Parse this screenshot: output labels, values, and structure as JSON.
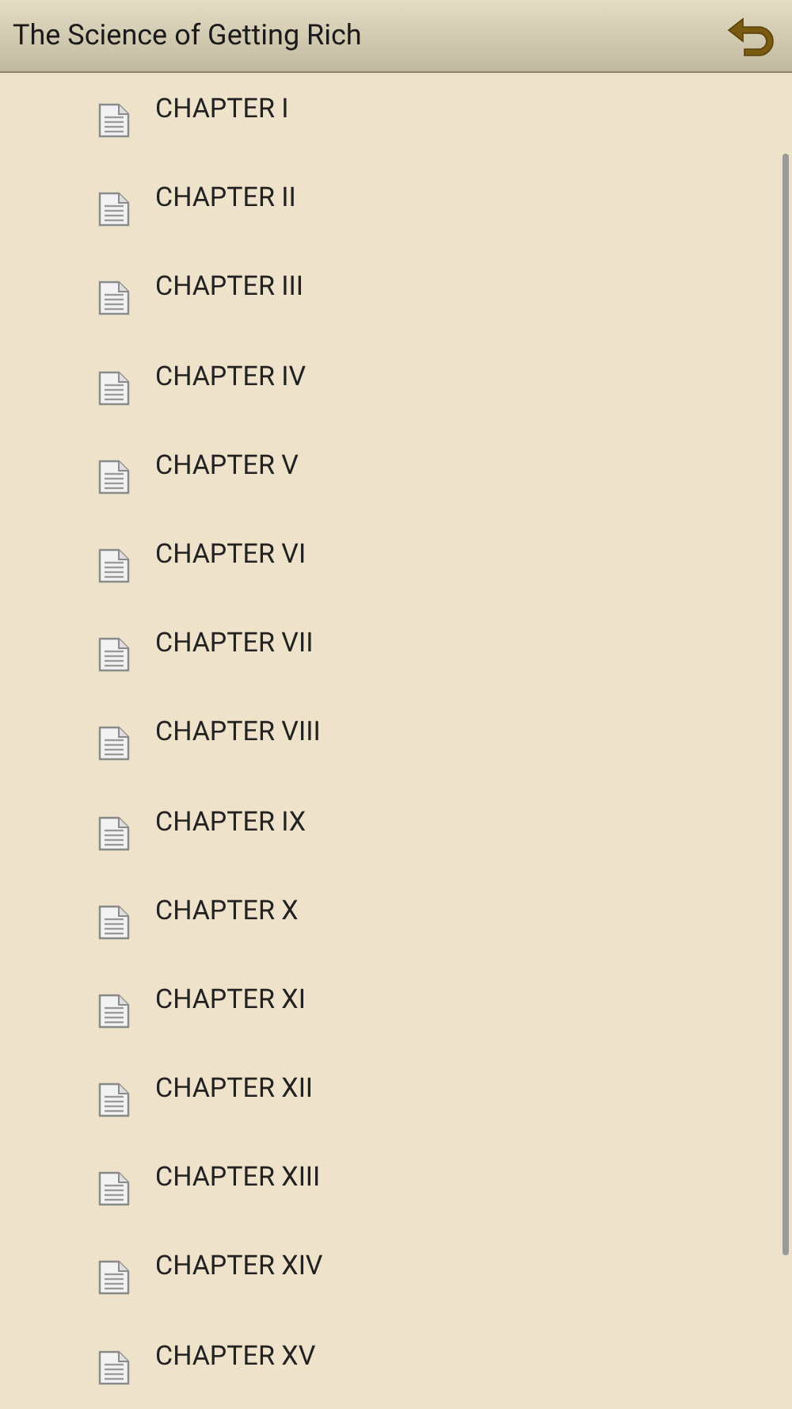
{
  "header": {
    "title": "The Science of Getting Rich"
  },
  "chapters": [
    {
      "label": "CHAPTER I"
    },
    {
      "label": "CHAPTER II"
    },
    {
      "label": "CHAPTER III"
    },
    {
      "label": "CHAPTER IV"
    },
    {
      "label": "CHAPTER V"
    },
    {
      "label": "CHAPTER VI"
    },
    {
      "label": "CHAPTER VII"
    },
    {
      "label": "CHAPTER VIII"
    },
    {
      "label": "CHAPTER IX"
    },
    {
      "label": "CHAPTER X"
    },
    {
      "label": "CHAPTER XI"
    },
    {
      "label": "CHAPTER XII"
    },
    {
      "label": "CHAPTER XIII"
    },
    {
      "label": "CHAPTER XIV"
    },
    {
      "label": "CHAPTER XV"
    }
  ]
}
